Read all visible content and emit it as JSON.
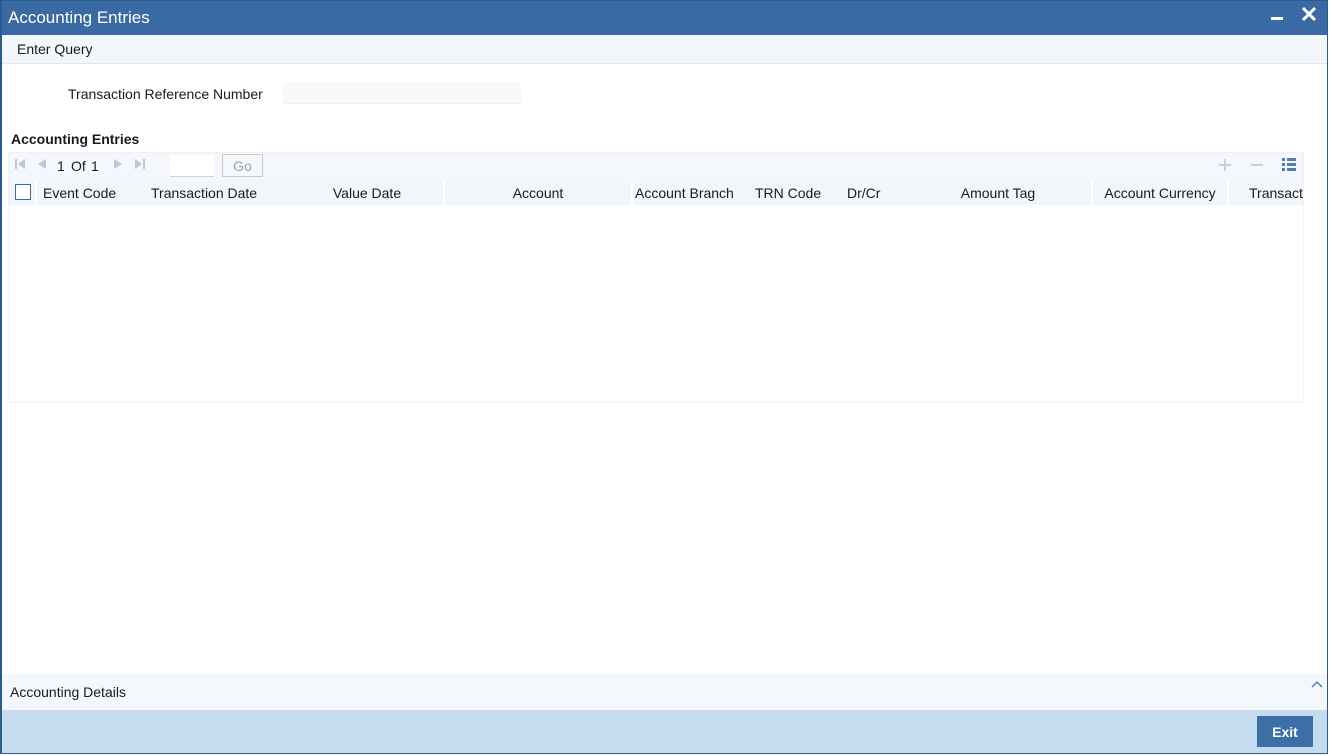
{
  "window": {
    "title": "Accounting Entries",
    "minimize_icon": "minimize-icon",
    "close_icon": "close-icon"
  },
  "menu": {
    "enter_query": "Enter Query"
  },
  "form": {
    "txn_ref_label": "Transaction Reference Number",
    "txn_ref_value": ""
  },
  "grid": {
    "section_title": "Accounting Entries",
    "pager": {
      "current": "1",
      "of": "Of",
      "total": "1",
      "go": "Go"
    },
    "tools": [
      "add-row-icon",
      "delete-row-icon",
      "single-view-icon"
    ],
    "columns": [
      {
        "key": "event_code",
        "label": "Event Code"
      },
      {
        "key": "txn_date",
        "label": "Transaction Date"
      },
      {
        "key": "value_date",
        "label": "Value Date"
      },
      {
        "key": "account",
        "label": "Account"
      },
      {
        "key": "account_branch",
        "label": "Account Branch"
      },
      {
        "key": "trn_code",
        "label": "TRN Code"
      },
      {
        "key": "dr_cr",
        "label": "Dr/Cr"
      },
      {
        "key": "amount_tag",
        "label": "Amount Tag"
      },
      {
        "key": "account_currency",
        "label": "Account Currency"
      },
      {
        "key": "transaction",
        "label": "Transact"
      }
    ],
    "rows": []
  },
  "footer": {
    "accounting_details": "Accounting Details",
    "collapse_icon": "chevron-up-icon"
  },
  "actions": {
    "exit": "Exit"
  },
  "colors": {
    "titlebar": "#3a6aa3",
    "accent": "#3d6fa6",
    "action_bar": "#c5dbee"
  }
}
